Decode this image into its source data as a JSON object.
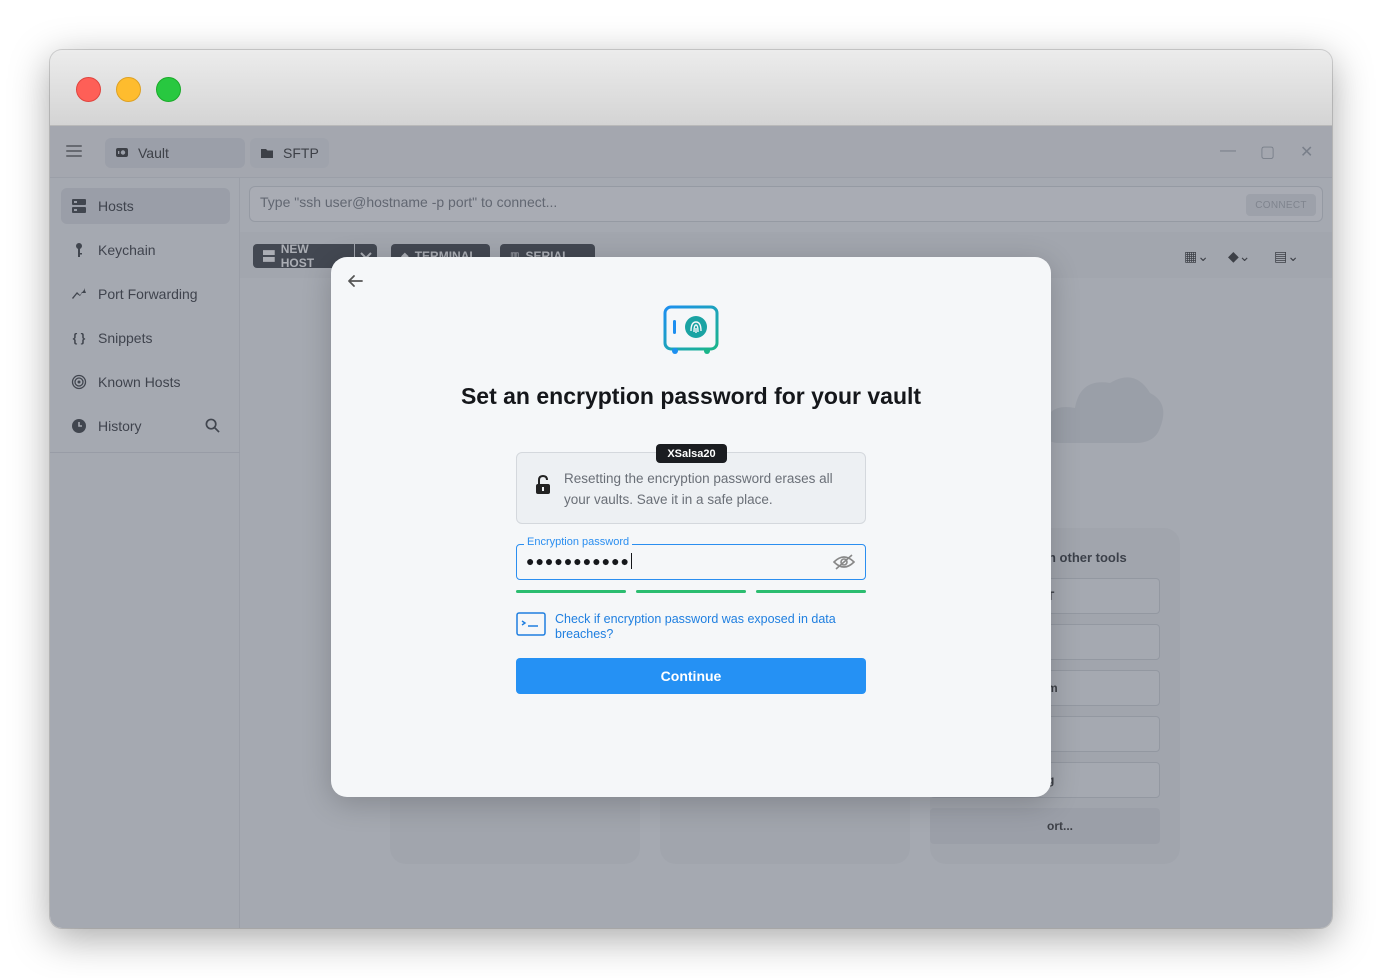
{
  "tabs": {
    "vault": "Vault",
    "sftp": "SFTP"
  },
  "window_controls": {
    "minimize": "—",
    "maximize": "▢",
    "close": "✕"
  },
  "sidebar": {
    "items": [
      {
        "label": "Hosts",
        "icon": "hosts-icon"
      },
      {
        "label": "Keychain",
        "icon": "key-icon"
      },
      {
        "label": "Port Forwarding",
        "icon": "forward-icon"
      },
      {
        "label": "Snippets",
        "icon": "braces-icon"
      },
      {
        "label": "Known Hosts",
        "icon": "fingerprint-icon"
      },
      {
        "label": "History",
        "icon": "clock-icon"
      }
    ]
  },
  "cmdbar": {
    "placeholder": "Type \"ssh user@hostname -p port\" to connect...",
    "connect": "CONNECT"
  },
  "toolbar": {
    "new_host": "NEW HOST",
    "terminal": "TERMINAL",
    "serial": "SERIAL"
  },
  "tools": {
    "title": "n other tools",
    "items": [
      "T",
      "",
      "m",
      "",
      "g",
      "ort..."
    ]
  },
  "modal": {
    "title": "Set an encryption password for your vault",
    "algorithm": "XSalsa20",
    "info": "Resetting the encryption password erases all your vaults. Save it in a safe place.",
    "password_label": "Encryption password",
    "password_value": "●●●●●●●●●●●",
    "breach_link": "Check if encryption password was exposed in data breaches?",
    "continue": "Continue"
  },
  "colors": {
    "accent": "#2591f4",
    "strength": "#2bbd70",
    "logo": "#1aa3a3"
  }
}
